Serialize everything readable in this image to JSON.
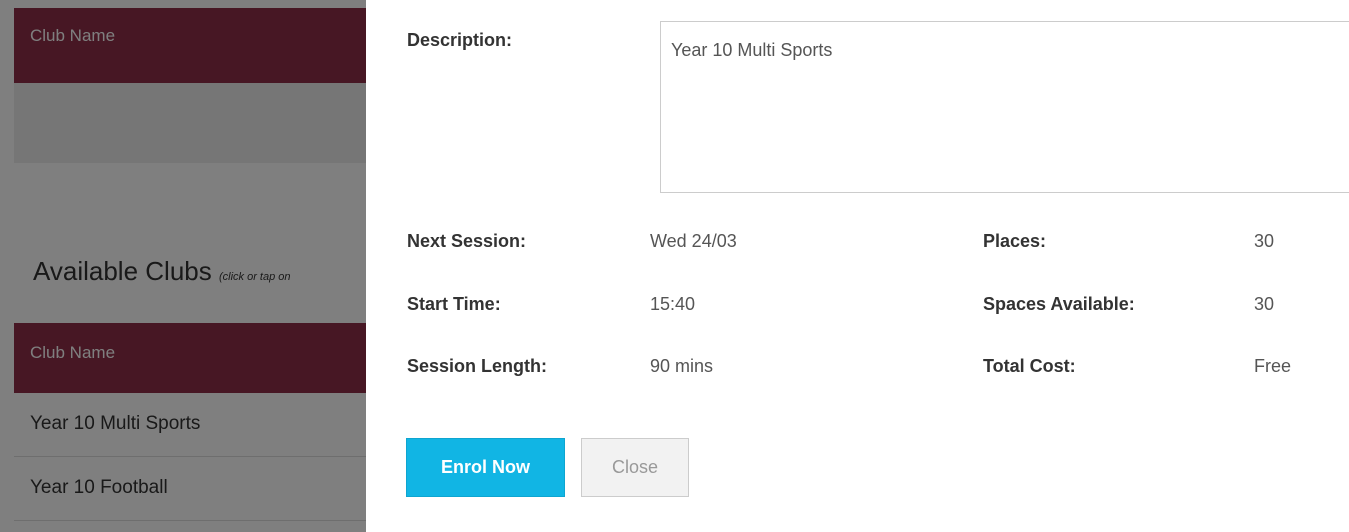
{
  "background": {
    "top_table_header": "Club Name",
    "available_title": "Available Clubs",
    "available_hint": "(click or tap on",
    "table_header": "Club Name",
    "clubs": [
      "Year 10 Multi Sports",
      "Year 10 Football"
    ]
  },
  "modal": {
    "description_label": "Description:",
    "description_value": "Year 10 Multi Sports",
    "next_session_label": "Next Session:",
    "next_session_value": "Wed 24/03",
    "start_time_label": "Start Time:",
    "start_time_value": "15:40",
    "session_length_label": "Session Length:",
    "session_length_value": "90 mins",
    "places_label": "Places:",
    "places_value": "30",
    "spaces_label": "Spaces Available:",
    "spaces_value": "30",
    "cost_label": "Total Cost:",
    "cost_value": "Free",
    "enrol_button": "Enrol Now",
    "close_button": "Close"
  },
  "colors": {
    "header_maroon": "#8e2f48",
    "enrol_blue": "#11b5e4"
  }
}
